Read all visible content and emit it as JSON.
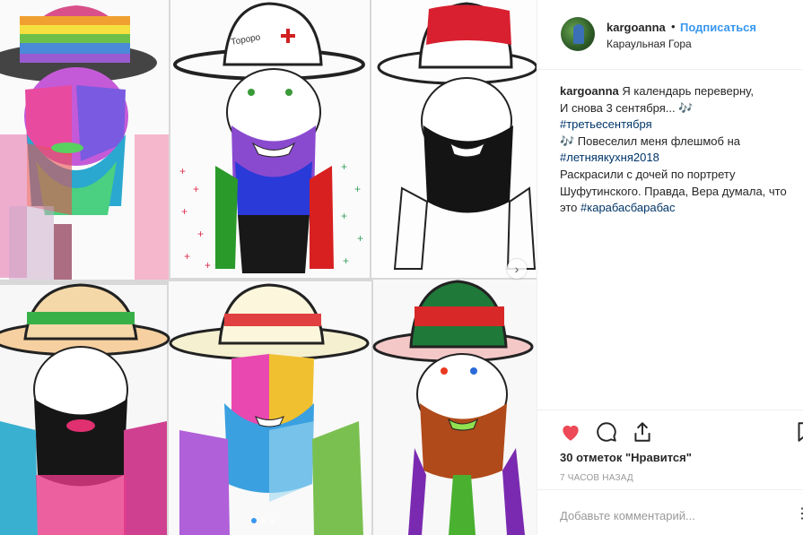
{
  "post": {
    "username": "kargoanna",
    "bullet": "•",
    "follow_label": "Подписаться",
    "location": "Караульная Гора"
  },
  "caption": {
    "username": "kargoanna",
    "line1": "Я календарь переверну,",
    "line2": "И снова 3 сентября... 🎶",
    "tag1": "#третьесентября",
    "line4": "🎶 Повеселил меня флешмоб на",
    "tag2": "#летняякухня2018",
    "line6": "Раскрасили с дочей по портрету",
    "line7": "Шуфутинского. Правда, Вера думала, что",
    "line8_prefix": "это",
    "tag3": "#карабасбарабас"
  },
  "actions": {
    "likes": "30 отметок \"Нравится\"",
    "time": "7 ЧАСОВ НАЗАД",
    "comment_placeholder": "Добавьте комментарий...",
    "more": "⋮"
  },
  "carousel": {
    "next_arrow": "›"
  },
  "colors": {
    "accent": "#3897f0",
    "like": "#ed4956",
    "hashtag": "#003569"
  },
  "icons": [
    "heart-icon",
    "comment-icon",
    "share-icon",
    "bookmark-icon",
    "chevron-right-icon"
  ]
}
